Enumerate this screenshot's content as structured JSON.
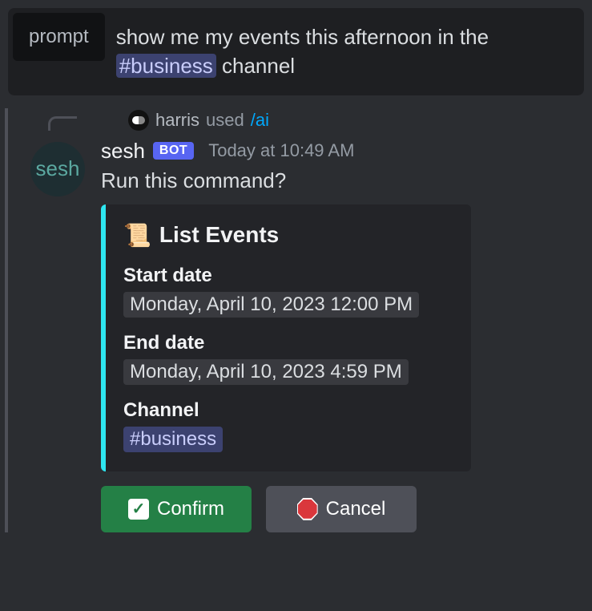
{
  "prompt": {
    "label": "prompt",
    "text_before": "show me my events this afternoon in the ",
    "channel": "#business",
    "text_after": " channel"
  },
  "reply": {
    "username": "harris",
    "used_text": "used",
    "command": "/ai"
  },
  "message": {
    "bot_name": "sesh",
    "bot_badge": "BOT",
    "timestamp": "Today at 10:49 AM",
    "avatar_text": "sesh",
    "text": "Run this command?"
  },
  "embed": {
    "title": "List Events",
    "icon": "scroll-icon",
    "fields": {
      "start": {
        "label": "Start date",
        "value": "Monday, April 10, 2023 12:00 PM"
      },
      "end": {
        "label": "End date",
        "value": "Monday, April 10, 2023 4:59 PM"
      },
      "channel": {
        "label": "Channel",
        "value": "#business"
      }
    }
  },
  "buttons": {
    "confirm": "Confirm",
    "cancel": "Cancel"
  }
}
